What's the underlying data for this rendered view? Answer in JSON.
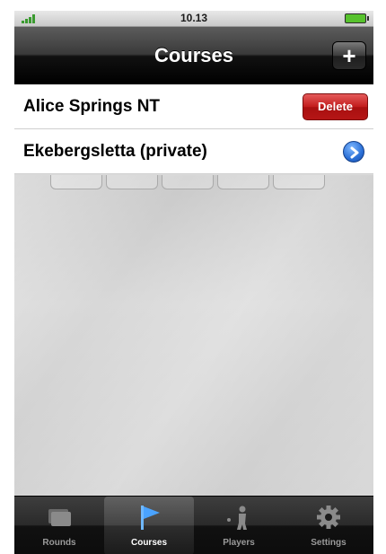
{
  "status_bar": {
    "time": "10.13"
  },
  "nav": {
    "title": "Courses",
    "add_label": "+"
  },
  "rows": [
    {
      "label": "Alice Springs NT",
      "action_label": "Delete"
    },
    {
      "label": "Ekebergsletta (private)"
    }
  ],
  "tabs": [
    {
      "label": "Rounds",
      "icon": "scorecard-icon",
      "active": false
    },
    {
      "label": "Courses",
      "icon": "flag-icon",
      "active": true
    },
    {
      "label": "Players",
      "icon": "golfer-icon",
      "active": false
    },
    {
      "label": "Settings",
      "icon": "gear-icon",
      "active": false
    }
  ],
  "colors": {
    "delete": "#c21c1c",
    "disclosure": "#2a6fd6",
    "active_tab_icon": "#4aa3ff",
    "battery": "#57c22d"
  }
}
